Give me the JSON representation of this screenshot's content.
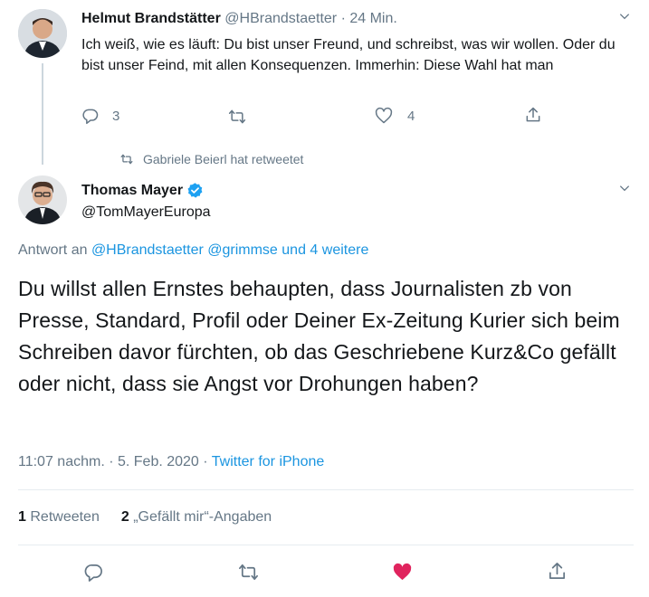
{
  "tweet1": {
    "author_name": "Helmut Brandstätter",
    "handle": "@HBrandstaetter",
    "separator": "·",
    "time": "24 Min.",
    "text": "Ich weiß, wie es läuft: Du bist unser Freund, und schreibst, was wir wollen. Oder du bist unser Feind, mit allen Konsequenzen. Immerhin: Diese Wahl hat man",
    "reply_count": "3",
    "like_count": "4"
  },
  "retweet_note": "Gabriele Beierl hat retweetet",
  "tweet2": {
    "author_name": "Thomas Mayer",
    "handle": "@TomMayerEuropa",
    "reply_prefix": "Antwort an",
    "reply_mention1": "@HBrandstaetter",
    "reply_mention2": "@grimmse",
    "reply_suffix": "und 4 weitere",
    "text": "Du willst allen Ernstes behaupten, dass Journalisten zb von Presse, Standard, Profil oder Deiner Ex-Zeitung Kurier sich beim Schreiben davor fürchten, ob das Geschriebene Kurz&Co gefällt oder nicht, dass sie Angst vor Drohungen haben?",
    "timestamp": "11:07 nachm. · 5. Feb. 2020 ·",
    "source": "Twitter for iPhone",
    "retweets_count": "1",
    "retweets_label": "Retweeten",
    "likes_count": "2",
    "likes_label": "„Gefällt mir“-Angaben"
  },
  "colors": {
    "accent": "#1b95e0",
    "muted": "#657786",
    "like_red": "#e0245e",
    "verified": "#1da1f2"
  }
}
